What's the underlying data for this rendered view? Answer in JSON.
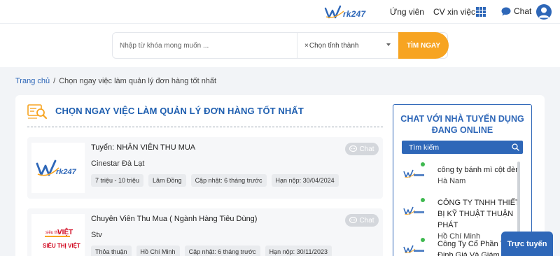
{
  "header": {
    "logo_text": "rk247",
    "nav": {
      "candidate": "Ứng viên",
      "cv": "CV xin việc",
      "chat": "Chat"
    }
  },
  "search": {
    "placeholder": "Nhập từ khóa mong muốn ...",
    "province_clear": "×",
    "province_label": "Chọn tỉnh thành",
    "button": "TÌM NGAY"
  },
  "breadcrumb": {
    "home": "Trang chủ",
    "separator": "/",
    "current": "Chọn ngay việc làm quản lý đơn hàng tốt nhất"
  },
  "section": {
    "title": "CHỌN NGAY VIỆC LÀM QUẢN LÝ ĐƠN HÀNG TỐT NHẤT"
  },
  "jobs": [
    {
      "title": "Tuyển: NHÂN VIÊN THU MUA",
      "company": "Cinestar Đà Lạt",
      "salary": "7 triệu - 10 triệu",
      "location": "Lâm Đồng",
      "updated": "Cập nhật: 6 tháng trước",
      "deadline": "Hạn nộp: 30/04/2024",
      "chat": "Chat",
      "logo": "rk247"
    },
    {
      "title": "Chuyên Viên Thu Mua ( Ngành Hàng Tiêu Dùng)",
      "company": "Stv",
      "salary": "Thỏa thuận",
      "location": "Hồ Chí Minh",
      "updated": "Cập nhật: 6 tháng trước",
      "deadline": "Hạn nộp: 30/11/2023",
      "chat": "Chat",
      "logo_top": "siêu thị",
      "logo_main": "VIỆT",
      "logo_bottom": "SIÊU THỊ VIỆT"
    }
  ],
  "sidebar": {
    "title_line1": "CHAT VỚI NHÀ TUYỂN DỤNG",
    "title_line2": "ĐANG ONLINE",
    "search_placeholder": "Tìm kiếm",
    "recruiters": [
      {
        "name": "công ty bánh mì cột đèn",
        "location": "Hà Nam"
      },
      {
        "name": "CÔNG TY TNHH THIẾT BỊ KỸ THUẬT THUẬN PHÁT",
        "location": "Hồ Chí Minh"
      },
      {
        "name": "Công Ty Cổ Phần Thẩm Định Giá Và Giám Định",
        "location": ""
      }
    ]
  },
  "floating": {
    "online_button": "Trực tuyến"
  },
  "colors": {
    "brand": "#2e67b8",
    "accent": "#f7a421",
    "online": "#3fb950"
  }
}
